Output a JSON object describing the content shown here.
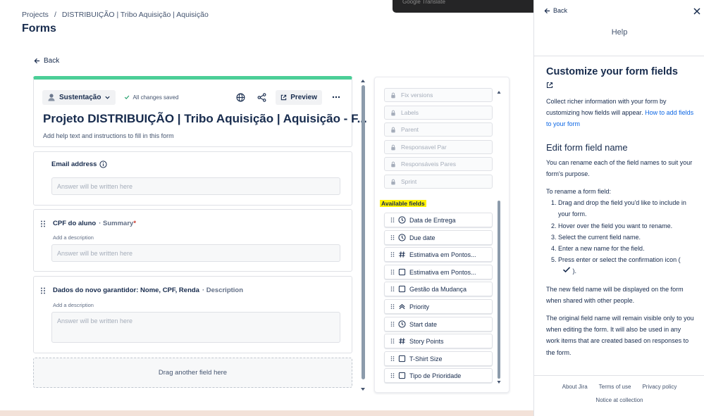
{
  "breadcrumb": {
    "items": [
      "Projects",
      "DISTRIBUIÇÃO | Tribo Aquisição | Aquisição"
    ],
    "separator": "/"
  },
  "page": {
    "title": "Forms",
    "back_label": "Back"
  },
  "form": {
    "project_label": "Sustentação",
    "saved_status": "All changes saved",
    "preview_label": "Preview",
    "title": "Projeto DISTRIBUIÇÃO | Tribo Aquisição | Aquisição - F...",
    "help_text": "Add help text and instructions to fill in this form",
    "fields": [
      {
        "label": "Email address",
        "type": "",
        "required": false,
        "description_hint": "",
        "placeholder": "Answer will be written here"
      },
      {
        "label": "CPF do aluno",
        "type": "· Summary",
        "required": true,
        "description_hint": "Add a description",
        "placeholder": "Answer will be written here"
      },
      {
        "label": "Dados do novo garantidor: Nome, CPF, Renda",
        "type": "· Description",
        "required": false,
        "description_hint": "Add a description",
        "placeholder": "Answer will be written here"
      }
    ],
    "required_mark": "*",
    "drop_zone": "Drag another field here"
  },
  "field_panel": {
    "used_fields": [
      "Fix versions",
      "Labels",
      "Parent",
      "Responsavel Par",
      "Responsáveis Pares",
      "Sprint"
    ],
    "available_title": "Available fields",
    "available_fields": [
      {
        "label": "Data de Entrega",
        "icon": "clock-icon"
      },
      {
        "label": "Due date",
        "icon": "clock-icon"
      },
      {
        "label": "Estimativa em Pontos...",
        "icon": "hash-icon"
      },
      {
        "label": "Estimativa em Pontos...",
        "icon": "checkbox-icon"
      },
      {
        "label": "Gestão da Mudança",
        "icon": "checkbox-icon"
      },
      {
        "label": "Priority",
        "icon": "priority-icon"
      },
      {
        "label": "Start date",
        "icon": "clock-icon"
      },
      {
        "label": "Story Points",
        "icon": "hash-icon"
      },
      {
        "label": "T-Shirt Size",
        "icon": "checkbox-icon"
      },
      {
        "label": "Tipo de Prioridade",
        "icon": "checkbox-icon"
      }
    ]
  },
  "translate_bar": {
    "label": "Google Translate"
  },
  "help": {
    "back_label": "Back",
    "heading": "Help",
    "title": "Customize your form fields",
    "intro": "Collect richer information with your form by customizing how fields will appear.",
    "intro_link": "How to add fields to your form",
    "section_title": "Edit form field name",
    "section_intro": "You can rename each of the field names to suit your form's purpose.",
    "steps_intro": "To rename a form field:",
    "steps": [
      "Drag and drop the field you'd like to include in your form.",
      "Hover over the field you want to rename.",
      "Select the current field name.",
      "Enter a new name for the field.",
      "Press enter or select the confirmation icon ("
    ],
    "step5_suffix": ").",
    "note1": "The new field name will be displayed on the form when shared with other people.",
    "note2": "The original field name will remain visible only to you when editing the form. It will also be used in any work items that are created based on responses to the form.",
    "footer_links": [
      "About Jira",
      "Terms of use",
      "Privacy policy"
    ],
    "footer_notice": "Notice at collection"
  },
  "colors": {
    "accent_green": "#4bce97",
    "link_blue": "#0c66e4",
    "highlight": "#fff200",
    "required_red": "#c9372c"
  }
}
